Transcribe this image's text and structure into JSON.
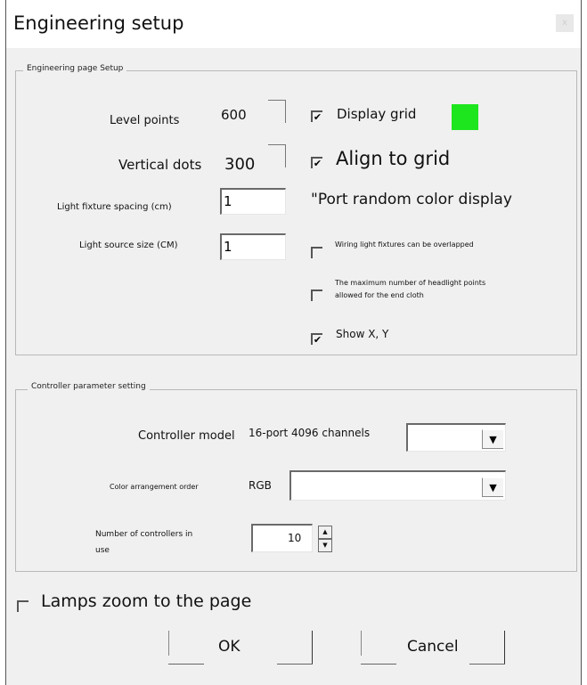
{
  "window": {
    "title": "Engineering setup"
  },
  "page_setup": {
    "legend": "Engineering page Setup",
    "level_points": {
      "label": "Level points",
      "value": "600"
    },
    "vertical_dots": {
      "label": "Vertical dots",
      "value": "300"
    },
    "fixture_spacing": {
      "label": "Light fixture spacing (cm)",
      "value": "1"
    },
    "source_size": {
      "label": "Light source size (CM)",
      "value": "1"
    },
    "display_grid": {
      "label": "Display grid",
      "checked": true,
      "mark": "✔"
    },
    "grid_color": "#1ee61e",
    "align_to_grid": {
      "label": "Align to grid",
      "checked": true,
      "mark": "✔"
    },
    "port_random_color": "\"Port random color display",
    "wiring_overlap": {
      "label": "Wiring light fixtures can be overlapped",
      "checked": false
    },
    "max_headlight": {
      "label_line1": "The maximum number of headlight points",
      "label_line2": "allowed for the end cloth",
      "checked": false
    },
    "show_xy": {
      "label": "Show X, Y",
      "checked": true,
      "mark": "✔"
    }
  },
  "controller": {
    "legend": "Controller parameter setting",
    "model": {
      "label": "Controller model",
      "value": "16-port 4096 channels"
    },
    "color_order": {
      "label": "Color arrangement order",
      "value": "RGB"
    },
    "count": {
      "label_line1": "Number of controllers in",
      "label_line2": "use",
      "value": "10"
    },
    "dropdown_arrow": "▼",
    "spin_up": "▲",
    "spin_down": "▼"
  },
  "lamps_zoom": {
    "label": "Lamps zoom to the page",
    "checked": false
  },
  "buttons": {
    "ok": "OK",
    "cancel": "Cancel"
  },
  "icons": {
    "close": "x"
  }
}
